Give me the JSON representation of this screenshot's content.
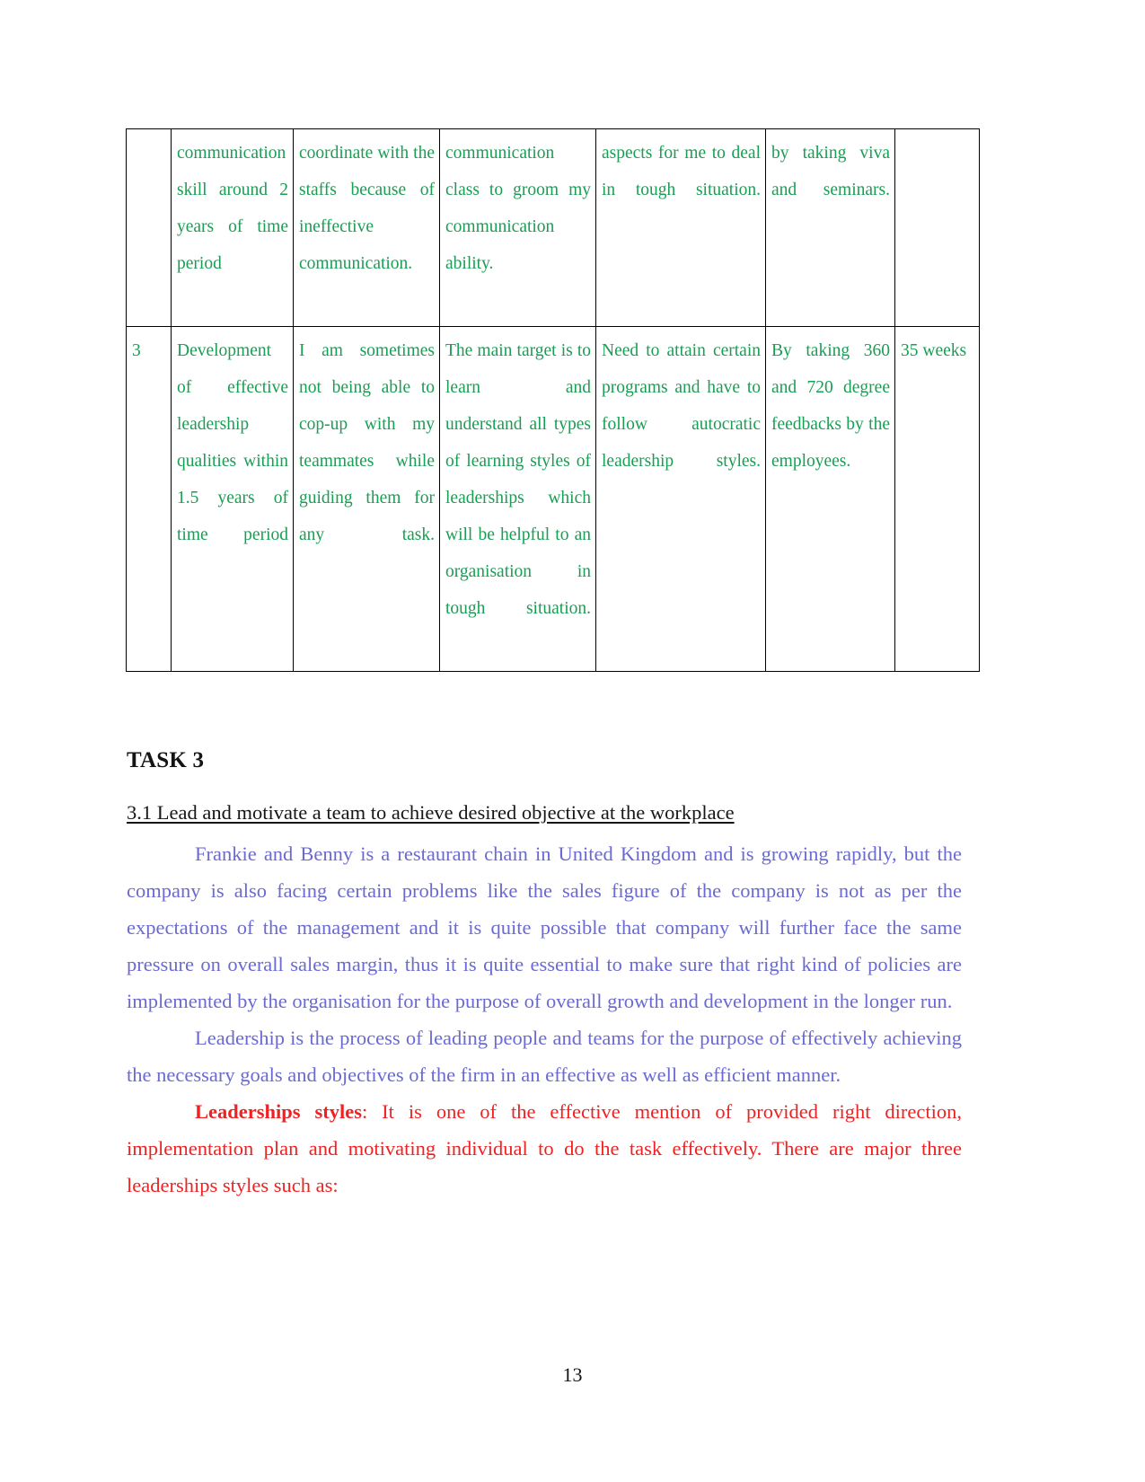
{
  "document": {
    "page_number": "13",
    "colors": {
      "table_text": "#1a9d54",
      "body_purple": "#6a6ad1",
      "body_red": "#ee2222",
      "heading_black": "#141414",
      "border": "#000000"
    }
  },
  "table": {
    "rows": [
      {
        "number": "",
        "goal": "communication skill around 2 years of time period",
        "current_proficiency": "coordinate with the staffs because of ineffective communication.",
        "target_proficiency": "communication class to groom my communication ability.",
        "development_opportunity": "aspects for me to deal in tough situation.",
        "criteria": "by taking viva and seminars.",
        "time_scale": ""
      },
      {
        "number": "3",
        "goal": "Development of effective leadership qualities within 1.5 years of time period",
        "current_proficiency": "I am sometimes not being able to cop-up with my teammates while guiding them for any task.",
        "target_proficiency": "The main target is to learn and understand all types of learning styles of leaderships which will be helpful to an organisation in tough situation.",
        "development_opportunity": "Need to attain certain programs and have to follow autocratic leadership styles.",
        "criteria": "By taking 360 and 720 degree feedbacks by the employees.",
        "time_scale": "35 weeks"
      }
    ]
  },
  "content": {
    "task_heading": "TASK 3",
    "sub_heading": "3.1 Lead and motivate a team to achieve desired objective at the workplace",
    "paragraph_1": "Frankie and Benny is a restaurant chain in United Kingdom and is growing rapidly, but the company is also facing certain problems like the sales figure of the company is not as per the expectations of the management and it is quite possible that company will further face the same pressure on overall sales margin, thus it is quite essential to make sure that right kind of policies are implemented by the organisation for the purpose of overall growth and development in the longer run.",
    "paragraph_2": "Leadership is the process of leading people and teams for the purpose of effectively achieving the necessary goals and objectives of the firm in an effective as well as efficient manner.",
    "paragraph_3_bold_lead": "Leaderships styles",
    "paragraph_3_rest": ": It is one of the effective mention of provided right direction, implementation plan and motivating individual to do the task effectively. There are major three leaderships styles such as:"
  }
}
